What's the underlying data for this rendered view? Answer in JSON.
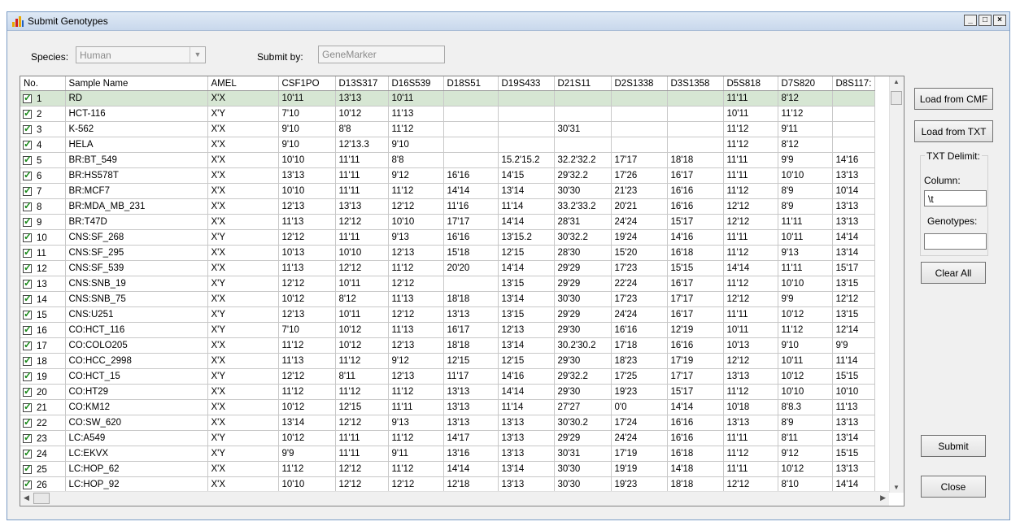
{
  "window": {
    "title": "Submit Genotypes",
    "minimize": "_",
    "maximize": "□",
    "close": "×"
  },
  "form": {
    "species_label": "Species:",
    "species_value": "Human",
    "submitby_label": "Submit by:",
    "submitby_value": "GeneMarker"
  },
  "grid": {
    "headers": [
      "No.",
      "Sample Name",
      "AMEL",
      "CSF1PO",
      "D13S317",
      "D16S539",
      "D18S51",
      "D19S433",
      "D21S11",
      "D2S1338",
      "D3S1358",
      "D5S818",
      "D7S820",
      "D8S117:"
    ],
    "rows": [
      [
        "1",
        "RD",
        "X'X",
        "10'11",
        "13'13",
        "10'11",
        "",
        "",
        "",
        "",
        "",
        "11'11",
        "8'12",
        ""
      ],
      [
        "2",
        "HCT-116",
        "X'Y",
        "7'10",
        "10'12",
        "11'13",
        "",
        "",
        "",
        "",
        "",
        "10'11",
        "11'12",
        ""
      ],
      [
        "3",
        "K-562",
        "X'X",
        "9'10",
        "8'8",
        "11'12",
        "",
        "",
        "30'31",
        "",
        "",
        "11'12",
        "9'11",
        ""
      ],
      [
        "4",
        "HELA",
        "X'X",
        "9'10",
        "12'13.3",
        "9'10",
        "",
        "",
        "",
        "",
        "",
        "11'12",
        "8'12",
        ""
      ],
      [
        "5",
        "BR:BT_549",
        "X'X",
        "10'10",
        "11'11",
        "8'8",
        "",
        "15.2'15.2",
        "32.2'32.2",
        "17'17",
        "18'18",
        "11'11",
        "9'9",
        "14'16"
      ],
      [
        "6",
        "BR:HS578T",
        "X'X",
        "13'13",
        "11'11",
        "9'12",
        "16'16",
        "14'15",
        "29'32.2",
        "17'26",
        "16'17",
        "11'11",
        "10'10",
        "13'13"
      ],
      [
        "7",
        "BR:MCF7",
        "X'X",
        "10'10",
        "11'11",
        "11'12",
        "14'14",
        "13'14",
        "30'30",
        "21'23",
        "16'16",
        "11'12",
        "8'9",
        "10'14"
      ],
      [
        "8",
        "BR:MDA_MB_231",
        "X'X",
        "12'13",
        "13'13",
        "12'12",
        "11'16",
        "11'14",
        "33.2'33.2",
        "20'21",
        "16'16",
        "12'12",
        "8'9",
        "13'13"
      ],
      [
        "9",
        "BR:T47D",
        "X'X",
        "11'13",
        "12'12",
        "10'10",
        "17'17",
        "14'14",
        "28'31",
        "24'24",
        "15'17",
        "12'12",
        "11'11",
        "13'13"
      ],
      [
        "10",
        "CNS:SF_268",
        "X'Y",
        "12'12",
        "11'11",
        "9'13",
        "16'16",
        "13'15.2",
        "30'32.2",
        "19'24",
        "14'16",
        "11'11",
        "10'11",
        "14'14"
      ],
      [
        "11",
        "CNS:SF_295",
        "X'X",
        "10'13",
        "10'10",
        "12'13",
        "15'18",
        "12'15",
        "28'30",
        "15'20",
        "16'18",
        "11'12",
        "9'13",
        "13'14"
      ],
      [
        "12",
        "CNS:SF_539",
        "X'X",
        "11'13",
        "12'12",
        "11'12",
        "20'20",
        "14'14",
        "29'29",
        "17'23",
        "15'15",
        "14'14",
        "11'11",
        "15'17"
      ],
      [
        "13",
        "CNS:SNB_19",
        "X'Y",
        "12'12",
        "10'11",
        "12'12",
        "",
        "13'15",
        "29'29",
        "22'24",
        "16'17",
        "11'12",
        "10'10",
        "13'15"
      ],
      [
        "14",
        "CNS:SNB_75",
        "X'X",
        "10'12",
        "8'12",
        "11'13",
        "18'18",
        "13'14",
        "30'30",
        "17'23",
        "17'17",
        "12'12",
        "9'9",
        "12'12"
      ],
      [
        "15",
        "CNS:U251",
        "X'Y",
        "12'13",
        "10'11",
        "12'12",
        "13'13",
        "13'15",
        "29'29",
        "24'24",
        "16'17",
        "11'11",
        "10'12",
        "13'15"
      ],
      [
        "16",
        "CO:HCT_116",
        "X'Y",
        "7'10",
        "10'12",
        "11'13",
        "16'17",
        "12'13",
        "29'30",
        "16'16",
        "12'19",
        "10'11",
        "11'12",
        "12'14"
      ],
      [
        "17",
        "CO:COLO205",
        "X'X",
        "11'12",
        "10'12",
        "12'13",
        "18'18",
        "13'14",
        "30.2'30.2",
        "17'18",
        "16'16",
        "10'13",
        "9'10",
        "9'9"
      ],
      [
        "18",
        "CO:HCC_2998",
        "X'X",
        "11'13",
        "11'12",
        "9'12",
        "12'15",
        "12'15",
        "29'30",
        "18'23",
        "17'19",
        "12'12",
        "10'11",
        "11'14"
      ],
      [
        "19",
        "CO:HCT_15",
        "X'Y",
        "12'12",
        "8'11",
        "12'13",
        "11'17",
        "14'16",
        "29'32.2",
        "17'25",
        "17'17",
        "13'13",
        "10'12",
        "15'15"
      ],
      [
        "20",
        "CO:HT29",
        "X'X",
        "11'12",
        "11'12",
        "11'12",
        "13'13",
        "14'14",
        "29'30",
        "19'23",
        "15'17",
        "11'12",
        "10'10",
        "10'10"
      ],
      [
        "21",
        "CO:KM12",
        "X'X",
        "10'12",
        "12'15",
        "11'11",
        "13'13",
        "11'14",
        "27'27",
        "0'0",
        "14'14",
        "10'18",
        "8'8.3",
        "11'13"
      ],
      [
        "22",
        "CO:SW_620",
        "X'X",
        "13'14",
        "12'12",
        "9'13",
        "13'13",
        "13'13",
        "30'30.2",
        "17'24",
        "16'16",
        "13'13",
        "8'9",
        "13'13"
      ],
      [
        "23",
        "LC:A549",
        "X'Y",
        "10'12",
        "11'11",
        "11'12",
        "14'17",
        "13'13",
        "29'29",
        "24'24",
        "16'16",
        "11'11",
        "8'11",
        "13'14"
      ],
      [
        "24",
        "LC:EKVX",
        "X'Y",
        "9'9",
        "11'11",
        "9'11",
        "13'16",
        "13'13",
        "30'31",
        "17'19",
        "16'18",
        "11'12",
        "9'12",
        "15'15"
      ],
      [
        "25",
        "LC:HOP_62",
        "X'X",
        "11'12",
        "12'12",
        "11'12",
        "14'14",
        "13'14",
        "30'30",
        "19'19",
        "14'18",
        "11'11",
        "10'12",
        "13'13"
      ],
      [
        "26",
        "LC:HOP_92",
        "X'X",
        "10'10",
        "12'12",
        "12'12",
        "12'18",
        "13'13",
        "30'30",
        "19'23",
        "18'18",
        "12'12",
        "8'10",
        "14'14"
      ]
    ],
    "selected_row": 0
  },
  "buttons": {
    "load_cmf": "Load from CMF",
    "load_txt": "Load from TXT",
    "clear_all": "Clear All",
    "submit": "Submit",
    "close": "Close"
  },
  "delimit": {
    "legend": "TXT Delimit:",
    "column_label": "Column:",
    "column_value": "\\t",
    "genotypes_label": "Genotypes:",
    "genotypes_value": ""
  },
  "colors": {
    "selected_row": "#d6e6d3",
    "check": "#1a8a1a"
  },
  "icons": {
    "app": "gene-app-icon",
    "check": "checkmark-icon"
  }
}
